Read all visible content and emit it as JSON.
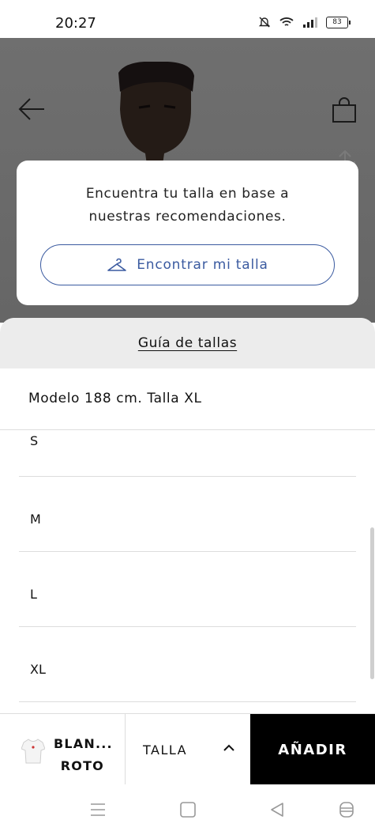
{
  "status_bar": {
    "time": "20:27",
    "battery": "83"
  },
  "header": {
    "icons": [
      "back-arrow-icon",
      "shopping-bag-icon",
      "share-icon"
    ]
  },
  "recommendation": {
    "line1": "Encuentra tu talla en base a",
    "line2": "nuestras recomendaciones.",
    "button_label": "Encontrar mi talla"
  },
  "sheet": {
    "guide_label": "Guía de tallas",
    "model_info": "Modelo 188 cm. Talla XL",
    "sizes": [
      "S",
      "M",
      "L",
      "XL"
    ]
  },
  "action_bar": {
    "product_line1": "BLAN...",
    "product_line2": "ROTO",
    "size_label": "TALLA",
    "add_label": "AÑADIR"
  },
  "colors": {
    "accent": "#3a5aa0",
    "cta": "#000000"
  }
}
